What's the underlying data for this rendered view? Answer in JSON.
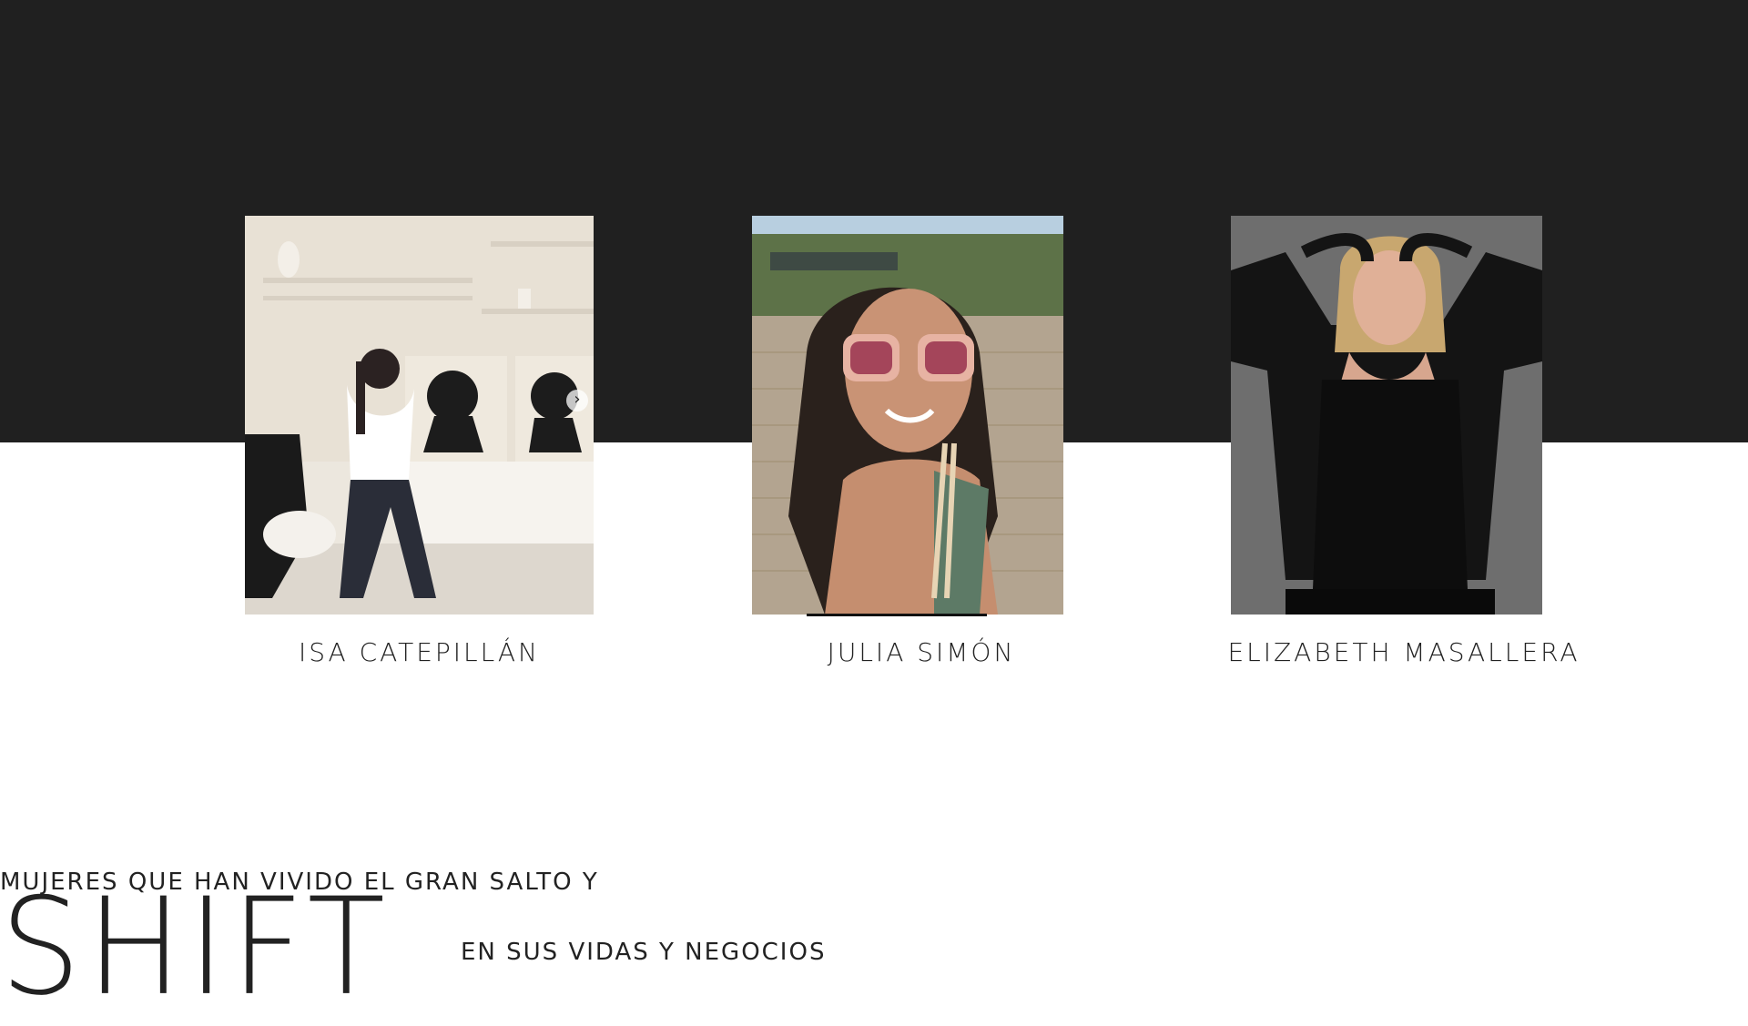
{
  "profiles": [
    {
      "name": "ISA CATEPILLÁN",
      "photo_icon": "woman-seated-portrait-icon"
    },
    {
      "name": "JULIA SIMÓN",
      "photo_icon": "woman-sunglasses-selfie-icon"
    },
    {
      "name": "ELIZABETH MASALLERA",
      "photo_icon": "woman-black-outfit-portrait-icon"
    }
  ],
  "carousel": {
    "next_icon": "chevron-right-icon",
    "next_glyph": "›"
  },
  "tagline": {
    "top": "MUJERES QUE HAN VIVIDO EL GRAN SALTO Y",
    "big_word": "SHIFT",
    "bottom": "EN SUS VIDAS Y NEGOCIOS"
  },
  "colors": {
    "dark_band": "#202020",
    "background": "#ffffff",
    "text": "#222222"
  }
}
